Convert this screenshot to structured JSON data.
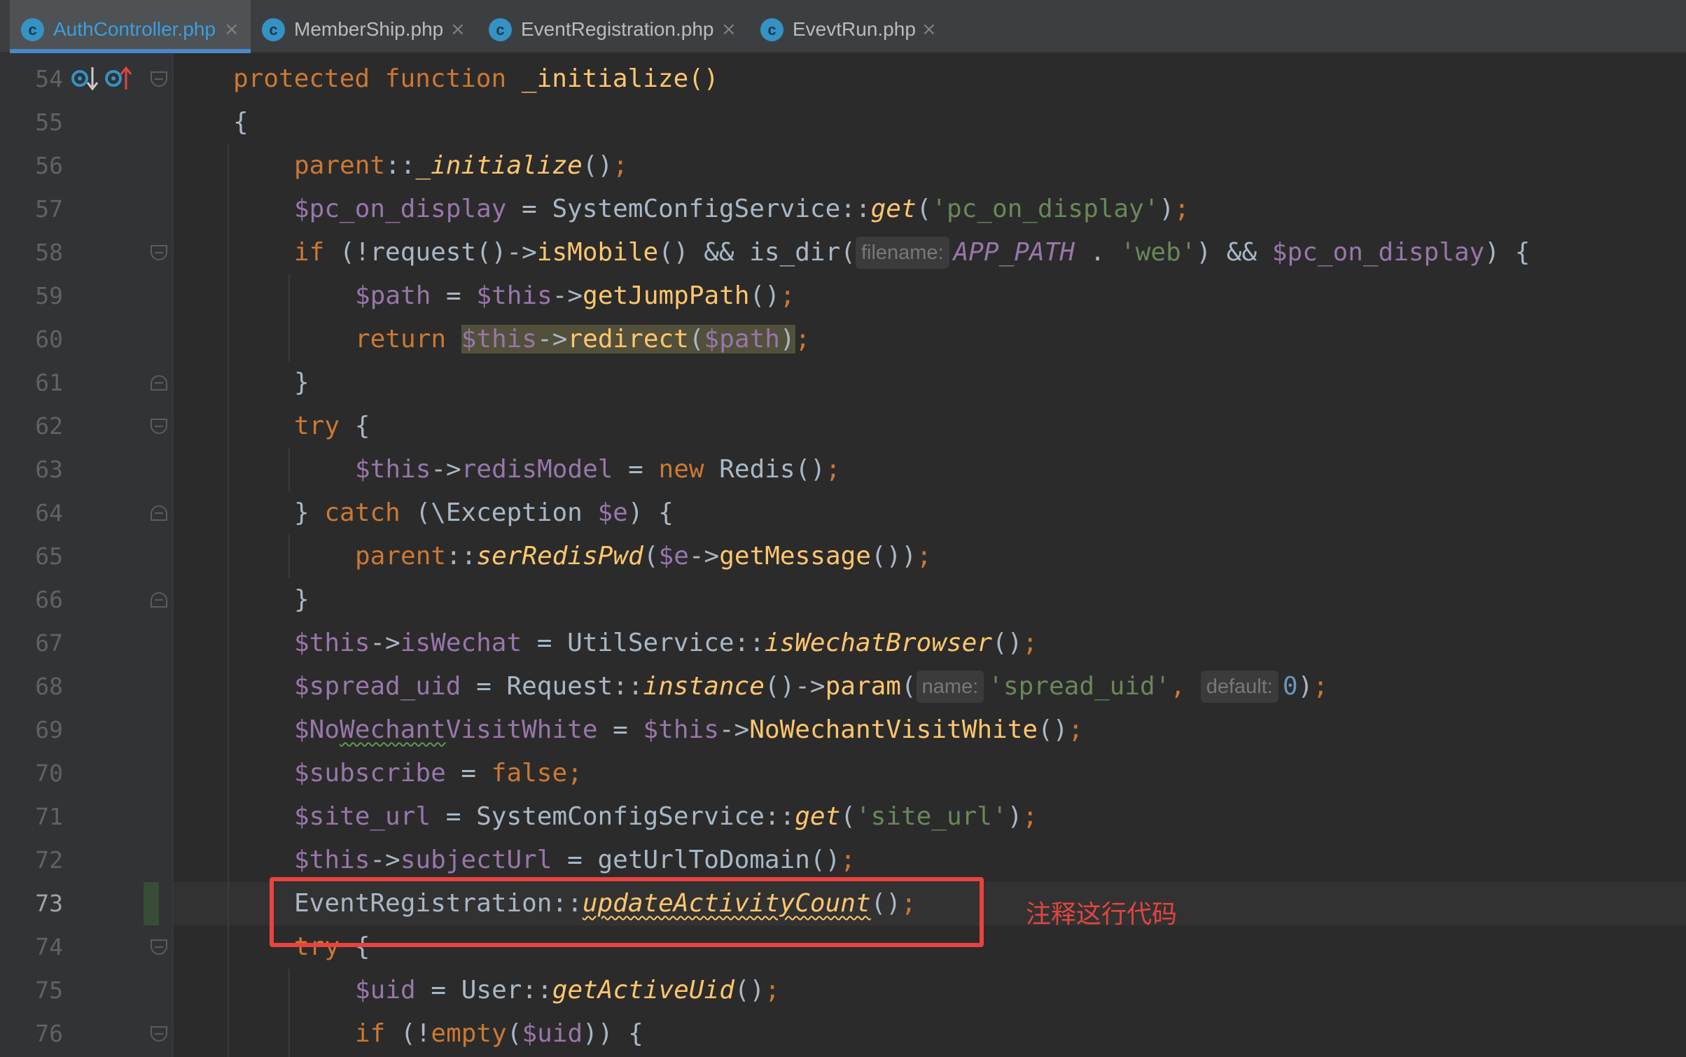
{
  "tabs": [
    {
      "label": "AuthController.php",
      "active": true
    },
    {
      "label": "MemberShip.php",
      "active": false
    },
    {
      "label": "EventRegistration.php",
      "active": false
    },
    {
      "label": "EvevtRun.php",
      "active": false
    }
  ],
  "tab_icon_letter": "c",
  "tab_close_glyph": "×",
  "line_numbers": [
    "54",
    "55",
    "56",
    "57",
    "58",
    "59",
    "60",
    "61",
    "62",
    "63",
    "64",
    "65",
    "66",
    "67",
    "68",
    "69",
    "70",
    "71",
    "72",
    "73",
    "74",
    "75",
    "76"
  ],
  "current_line": "73",
  "colors": {
    "accent": "#4a88c7",
    "annotation_red": "#e9423f"
  },
  "code": {
    "l54": {
      "t1": "protected",
      "t2": "function",
      "t3": "_initialize()"
    },
    "l55": {
      "t1": "{"
    },
    "l56": {
      "t1": "parent",
      "t2": "::",
      "t3": "_initialize",
      "t4": "()",
      "t5": ";"
    },
    "l57": {
      "t1": "$pc_on_display",
      "t2": " = SystemConfigService::",
      "t3": "get",
      "t4": "(",
      "t5": "'pc_on_display'",
      "t6": ")",
      "t7": ";"
    },
    "l58": {
      "t1": "if",
      "t2": " (!request()->",
      "t3": "isMobile",
      "t4": "() && is_dir(",
      "hint": "filename:",
      "t5": "APP_PATH",
      "t6": " . ",
      "t7": "'web'",
      "t8": ") && ",
      "t9": "$pc_on_display",
      "t10": ") {"
    },
    "l59": {
      "t1": "$path",
      "t2": " = ",
      "t3": "$this",
      "t4": "->",
      "t5": "getJumpPath",
      "t6": "()",
      "t7": ";"
    },
    "l60": {
      "t1": "return",
      "t2": "$this",
      "t3": "->",
      "t4": "redirect",
      "t5": "(",
      "t6": "$path",
      "t7": ")",
      "t8": ";"
    },
    "l61": {
      "t1": "}"
    },
    "l62": {
      "t1": "try",
      "t2": " {"
    },
    "l63": {
      "t1": "$this",
      "t2": "->",
      "t3": "redisModel",
      "t4": " = ",
      "t5": "new",
      "t6": " Redis()",
      "t7": ";"
    },
    "l64": {
      "t1": "} ",
      "t2": "catch",
      "t3": " (\\Exception ",
      "t4": "$e",
      "t5": ") {"
    },
    "l65": {
      "t1": "parent",
      "t2": "::",
      "t3": "serRedisPwd",
      "t4": "(",
      "t5": "$e",
      "t6": "->",
      "t7": "getMessage",
      "t8": "())",
      "t9": ";"
    },
    "l66": {
      "t1": "}"
    },
    "l67": {
      "t1": "$this",
      "t2": "->",
      "t3": "isWechat",
      "t4": " = UtilService::",
      "t5": "isWechatBrowser",
      "t6": "()",
      "t7": ";"
    },
    "l68": {
      "t1": "$spread_uid",
      "t2": " = Request::",
      "t3": "instance",
      "t4": "()->",
      "t5": "param",
      "t6": "(",
      "hint1": "name:",
      "t7": "'spread_uid'",
      "t8": ", ",
      "hint2": "default:",
      "t9": "0",
      "t10": ")",
      "t11": ";"
    },
    "l69": {
      "t1": "$No",
      "t2": "Wechant",
      "t3": "VisitWhite",
      "t4": " = ",
      "t5": "$this",
      "t6": "->",
      "t7": "NoWechantVisitWhite",
      "t8": "()",
      "t9": ";"
    },
    "l70": {
      "t1": "$subscribe",
      "t2": " = ",
      "t3": "false",
      "t4": ";"
    },
    "l71": {
      "t1": "$site_url",
      "t2": " = SystemConfigService::",
      "t3": "get",
      "t4": "(",
      "t5": "'site_url'",
      "t6": ")",
      "t7": ";"
    },
    "l72": {
      "t1": "$this",
      "t2": "->",
      "t3": "subjectUrl",
      "t4": " = getUrlToDomain()",
      "t5": ";"
    },
    "l73": {
      "t1": "EventRegistration::",
      "t2": "updateActivityCount",
      "t3": "()",
      "t4": ";"
    },
    "l74": {
      "t1": "try",
      "t2": " {"
    },
    "l75": {
      "t1": "$uid",
      "t2": " = User::",
      "t3": "getActiveUid",
      "t4": "()",
      "t5": ";"
    },
    "l76": {
      "t1": "if",
      "t2": " (!",
      "t3": "empty",
      "t4": "(",
      "t5": "$uid",
      "t6": ")) {"
    }
  },
  "annotation": "注释这行代码"
}
